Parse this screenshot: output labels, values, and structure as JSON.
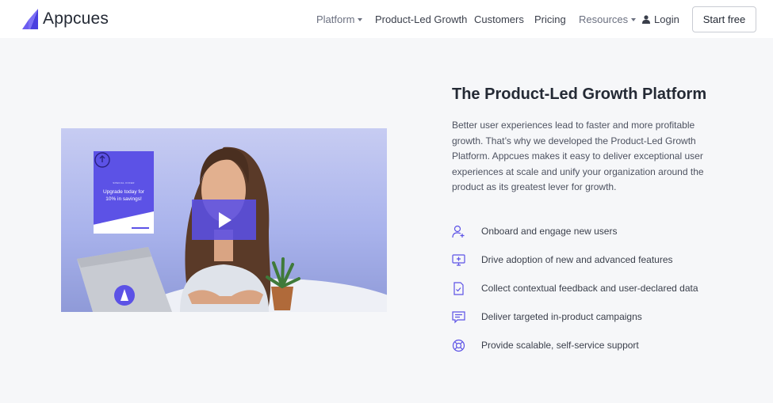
{
  "brand": {
    "name": "Appcues",
    "accent": "#5c52e6"
  },
  "nav": {
    "platform": "Platform",
    "plg": "Product-Led Growth",
    "customers": "Customers",
    "pricing": "Pricing",
    "resources": "Resources",
    "login": "Login",
    "start": "Start free"
  },
  "video": {
    "card_small": "SPECIAL OFFER",
    "card_text": "Upgrade today for 10% in savings!"
  },
  "hero": {
    "title": "The Product-Led Growth Platform",
    "description": "Better user experiences lead to faster and more profitable growth. That’s why we developed the Product-Led Growth Platform. Appcues makes it easy to deliver exceptional user experiences at scale and unify your organization around the product as its greatest lever for growth."
  },
  "features": [
    {
      "icon": "user-plus-icon",
      "text": "Onboard and engage new users"
    },
    {
      "icon": "monitor-plus-icon",
      "text": "Drive adoption of new and advanced features"
    },
    {
      "icon": "document-check-icon",
      "text": "Collect contextual feedback and user-declared data"
    },
    {
      "icon": "chat-message-icon",
      "text": "Deliver targeted in-product campaigns"
    },
    {
      "icon": "lifebuoy-icon",
      "text": "Provide scalable, self-service support"
    }
  ]
}
